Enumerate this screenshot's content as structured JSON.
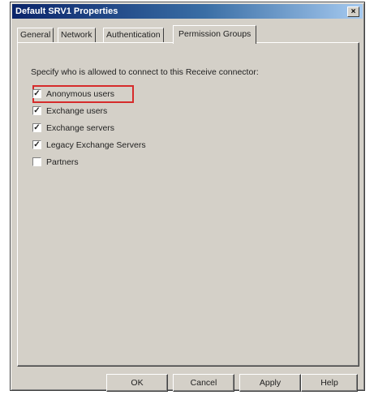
{
  "window": {
    "title": "Default SRV1 Properties",
    "close_label": "×"
  },
  "tabs": [
    {
      "label": "General"
    },
    {
      "label": "Network"
    },
    {
      "label": "Authentication"
    },
    {
      "label": "Permission Groups"
    }
  ],
  "panel": {
    "description": "Specify who is allowed to connect to this Receive connector:",
    "checkboxes": [
      {
        "label": "Anonymous users",
        "checked": true,
        "mark": "✓",
        "highlighted": true
      },
      {
        "label": "Exchange users",
        "checked": true,
        "mark": "✓"
      },
      {
        "label": "Exchange servers",
        "checked": true,
        "mark": "✓"
      },
      {
        "label": "Legacy Exchange Servers",
        "checked": true,
        "mark": "✓"
      },
      {
        "label": "Partners",
        "checked": false,
        "mark": ""
      }
    ]
  },
  "buttons": {
    "ok": "OK",
    "cancel": "Cancel",
    "apply": "Apply",
    "help": "Help"
  },
  "colors": {
    "highlight": "#d62b2b",
    "titlebar": "#0a246a"
  }
}
